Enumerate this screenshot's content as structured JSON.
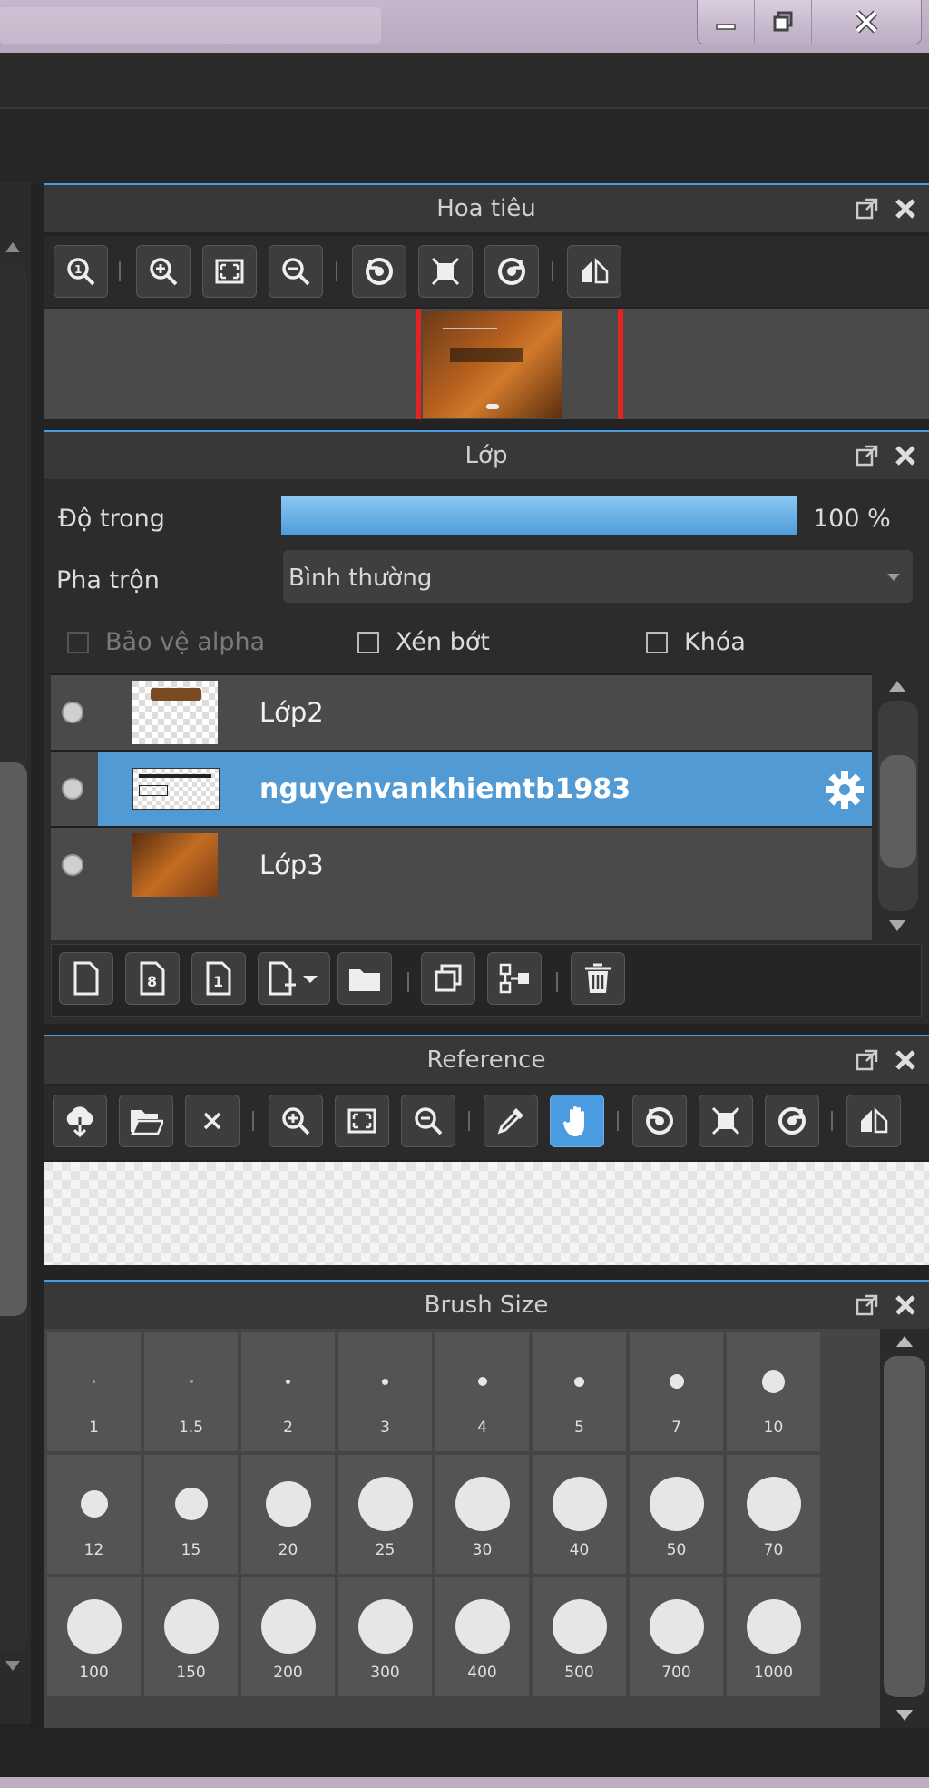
{
  "window": {
    "minimize_icon": "minimize-icon",
    "maximize_icon": "restore-icon",
    "close_icon": "close-icon"
  },
  "navigator": {
    "title": "Hoa tiêu",
    "tools": [
      "zoom-reset-icon",
      "zoom-in-icon",
      "fit-icon",
      "zoom-out-icon",
      "rotate-left-icon",
      "fit-window-icon",
      "rotate-right-icon",
      "flip-icon"
    ]
  },
  "layers": {
    "title": "Lớp",
    "opacity_label": "Độ trong",
    "opacity_value": "100 %",
    "opacity_fraction": 1.0,
    "blend_label": "Pha trộn",
    "blend_value": "Bình thường",
    "protect_alpha_label": "Bảo vệ alpha",
    "clip_label": "Xén bớt",
    "lock_label": "Khóa",
    "items": [
      {
        "name": "Lớp2",
        "selected": false
      },
      {
        "name": "nguyenvankhiemtb1983",
        "selected": true
      },
      {
        "name": "Lớp3",
        "selected": false
      }
    ],
    "tools": [
      "new-layer-icon",
      "new-8bit-layer-icon",
      "new-1bit-layer-icon",
      "add-layer-menu-icon",
      "folder-icon",
      "duplicate-icon",
      "merge-icon",
      "delete-icon"
    ]
  },
  "reference": {
    "title": "Reference",
    "tools": [
      "open-cloud-icon",
      "open-folder-icon",
      "close-icon",
      "zoom-in-icon",
      "fit-icon",
      "zoom-out-icon",
      "eyedropper-icon",
      "hand-icon",
      "rotate-left-icon",
      "fit-window-icon",
      "rotate-right-icon",
      "flip-icon"
    ]
  },
  "brush_size": {
    "title": "Brush Size",
    "sizes": [
      "1",
      "1.5",
      "2",
      "3",
      "4",
      "5",
      "7",
      "10",
      "12",
      "15",
      "20",
      "25",
      "30",
      "40",
      "50",
      "70",
      "100",
      "150",
      "200",
      "300",
      "400",
      "500",
      "700",
      "1000"
    ]
  },
  "colors": {
    "accent": "#4a9be0",
    "selected_row": "#519ad3",
    "panel": "#383838",
    "background": "#232323"
  }
}
